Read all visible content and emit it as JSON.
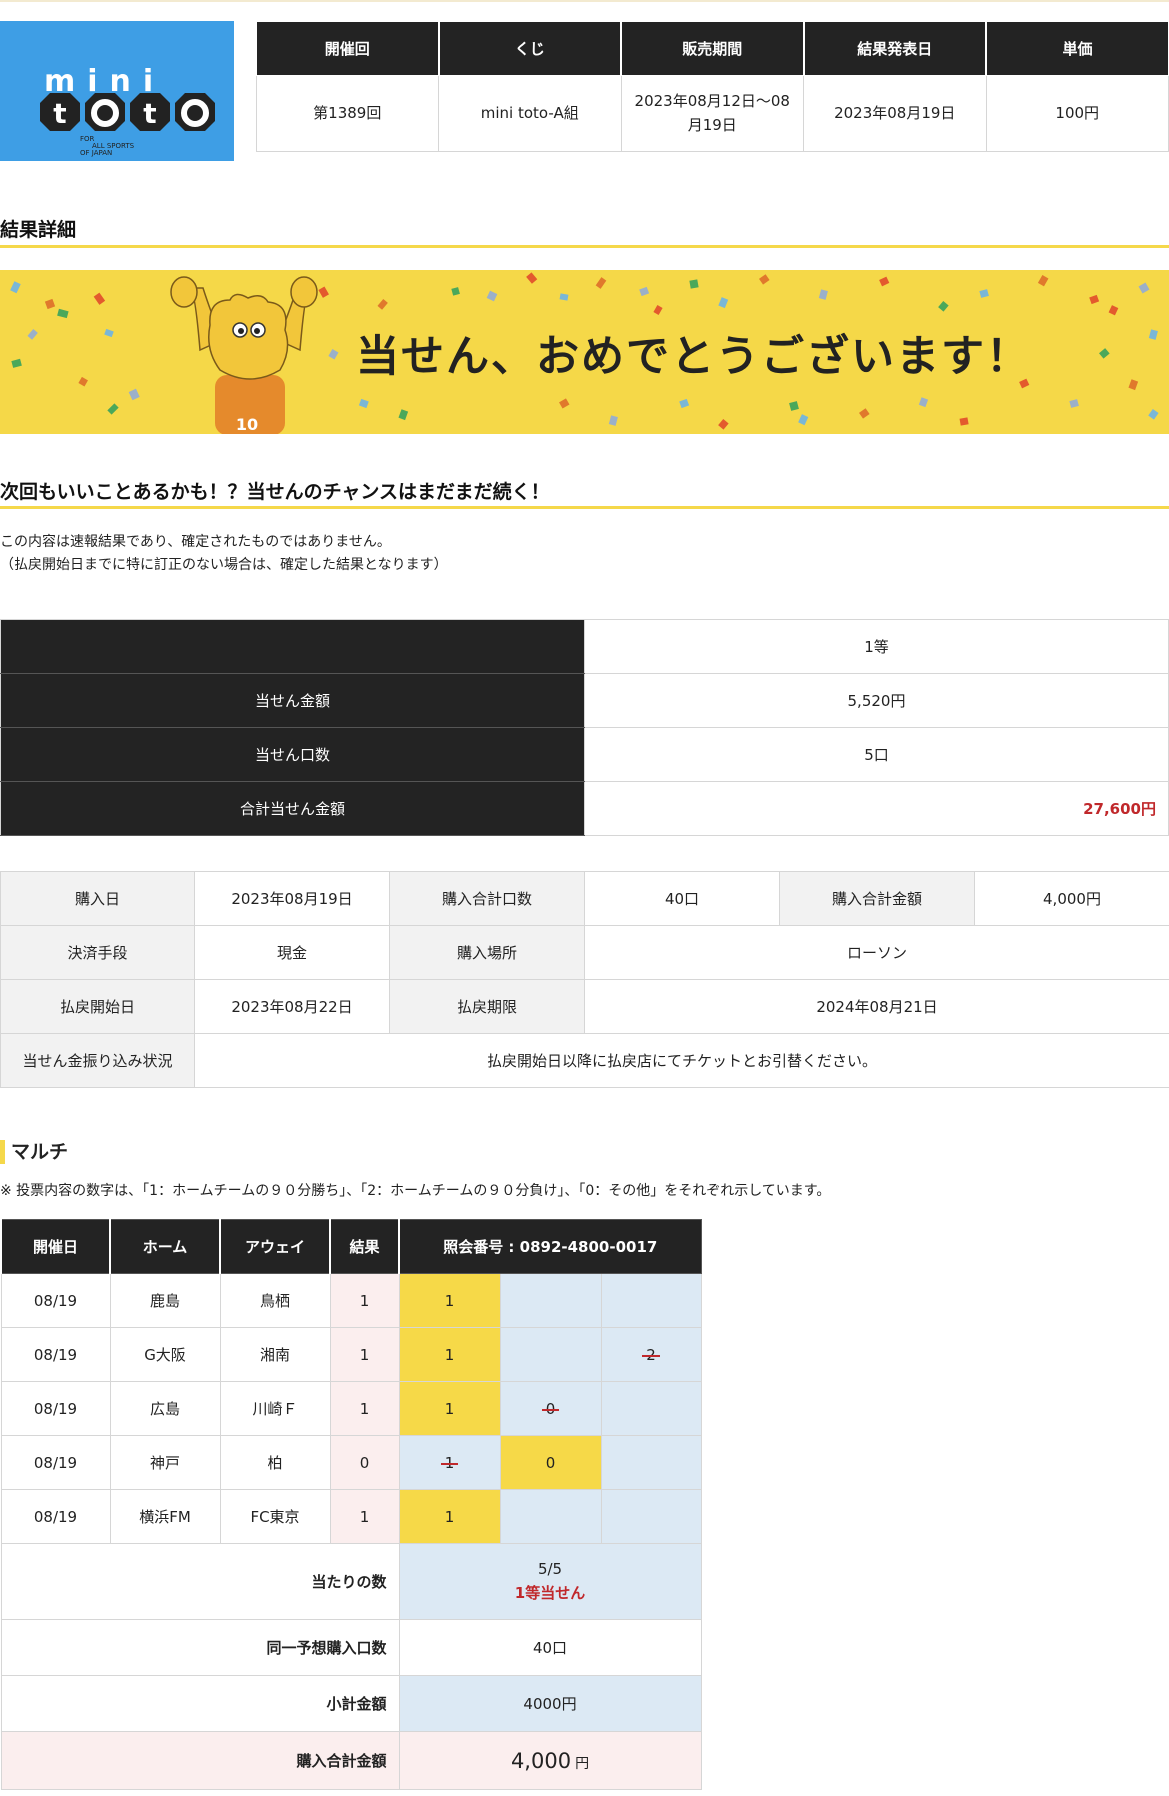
{
  "logo": {
    "line1": "mini",
    "line2": "toto",
    "tagline": [
      "FOR",
      "ALL SPORTS",
      "OF JAPAN"
    ]
  },
  "info": {
    "headers": [
      "開催回",
      "くじ",
      "販売期間",
      "結果発表日",
      "単価"
    ],
    "values": [
      "第1389回",
      "mini toto-A組",
      "2023年08月12日〜08月19日",
      "2023年08月19日",
      "100円"
    ]
  },
  "result_title": "結果詳細",
  "banner": {
    "message": "当せん、おめでとうございます！",
    "mascot_number": "10"
  },
  "chance_title": "次回もいいことあるかも！？当せんのチャンスはまだまだ続く！",
  "notice": {
    "line1": "この内容は速報結果であり、確定されたものではありません。",
    "line2": "（払戻開始日までに特に訂正のない場合は、確定した結果となります）"
  },
  "prize": {
    "grade": "1等",
    "rows": [
      {
        "label": "当せん金額",
        "value": "5,520円"
      },
      {
        "label": "当せん口数",
        "value": "5口"
      },
      {
        "label": "合計当せん金額",
        "value": "27,600円"
      }
    ]
  },
  "purchase": {
    "date_label": "購入日",
    "date": "2023年08月19日",
    "units_label": "購入合計口数",
    "units": "40口",
    "amount_label": "購入合計金額",
    "amount": "4,000円",
    "payment_label": "決済手段",
    "payment": "現金",
    "place_label": "購入場所",
    "place": "ローソン",
    "refund_start_label": "払戻開始日",
    "refund_start": "2023年08月22日",
    "refund_limit_label": "払戻期限",
    "refund_limit": "2024年08月21日",
    "transfer_label": "当せん金振り込み状況",
    "transfer": "払戻開始日以降に払戻店にてチケットとお引替ください。"
  },
  "multi": {
    "title": "マルチ",
    "note": "※ 投票内容の数字は、「1：ホームチームの９０分勝ち」、「2：ホームチームの９０分負け」、「0：その他」をそれぞれ示しています。",
    "headers": {
      "date": "開催日",
      "home": "ホーム",
      "away": "アウェイ",
      "result": "結果",
      "ref": "照会番号 : 0892-4800-0017"
    },
    "matches": [
      {
        "date": "08/19",
        "home": "鹿島",
        "away": "鳥栖",
        "result": "1",
        "picks": [
          "1",
          "",
          ""
        ]
      },
      {
        "date": "08/19",
        "home": "G大阪",
        "away": "湘南",
        "result": "1",
        "picks": [
          "1",
          "",
          "2"
        ]
      },
      {
        "date": "08/19",
        "home": "広島",
        "away": "川崎Ｆ",
        "result": "1",
        "picks": [
          "1",
          "0",
          ""
        ]
      },
      {
        "date": "08/19",
        "home": "神戸",
        "away": "柏",
        "result": "0",
        "picks": [
          "1",
          "0",
          ""
        ]
      },
      {
        "date": "08/19",
        "home": "横浜FM",
        "away": "FC東京",
        "result": "1",
        "picks": [
          "1",
          "",
          ""
        ]
      }
    ],
    "hits_label": "当たりの数",
    "hits": "5/5",
    "hits_grade": "1等当せん",
    "same_label": "同一予想購入口数",
    "same": "40口",
    "subtotal_label": "小計金額",
    "subtotal": "4000円",
    "total_label": "購入合計金額",
    "total": "4,000",
    "total_unit": "円"
  },
  "colors": {
    "yellow": "#f5d848",
    "dark": "#232323",
    "red": "#c0282b",
    "blue_cell": "#dce9f4",
    "pink_cell": "#fbeeee",
    "logo_blue": "#3e9ee5"
  }
}
